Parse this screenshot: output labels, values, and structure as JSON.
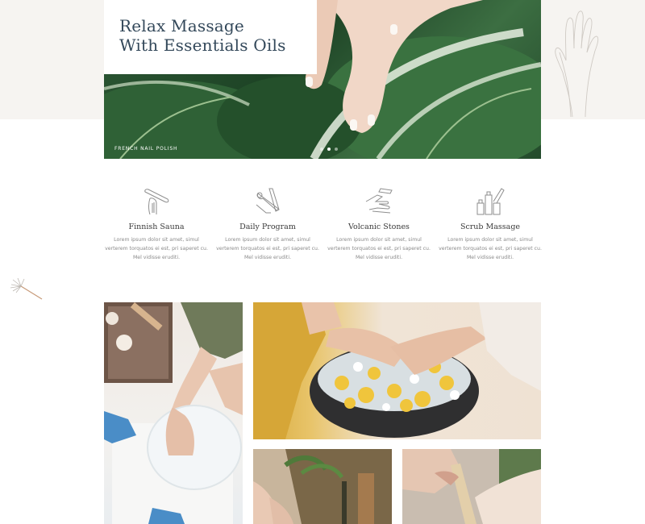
{
  "hero": {
    "title": "Relax Massage\nWith Essentials Oils",
    "caption": "FRENCH NAIL POLISH",
    "slides": [
      {
        "active": false
      },
      {
        "active": true
      },
      {
        "active": false
      }
    ]
  },
  "features": [
    {
      "title": "Finnish Sauna",
      "icon": "nail-file-icon",
      "text": "Lorem ipsum dolor sit amet, simul verterem torquatos ei est, pri saperet cu. Mel vidisse eruditi."
    },
    {
      "title": "Daily Program",
      "icon": "nail-clipper-icon",
      "text": "Lorem ipsum dolor sit amet, simul verterem torquatos ei est, pri saperet cu. Mel vidisse eruditi."
    },
    {
      "title": "Volcanic Stones",
      "icon": "manicure-hand-icon",
      "text": "Lorem ipsum dolor sit amet, simul verterem torquatos ei est, pri saperet cu. Mel vidisse eruditi."
    },
    {
      "title": "Scrub Massage",
      "icon": "cosmetic-bottles-icon",
      "text": "Lorem ipsum dolor sit amet, simul verterem torquatos ei est, pri saperet cu. Mel vidisse eruditi."
    }
  ],
  "gallery": [
    {
      "icon": "manicure-bowl-photo"
    },
    {
      "icon": "foot-bath-flowers-photo"
    },
    {
      "icon": "pedicure-photo"
    },
    {
      "icon": "waxing-photo"
    }
  ],
  "colors": {
    "band": "#f6f4f1",
    "title": "#33485a",
    "text": "#8a8a8a",
    "leaf_green": "#2e5a36"
  }
}
